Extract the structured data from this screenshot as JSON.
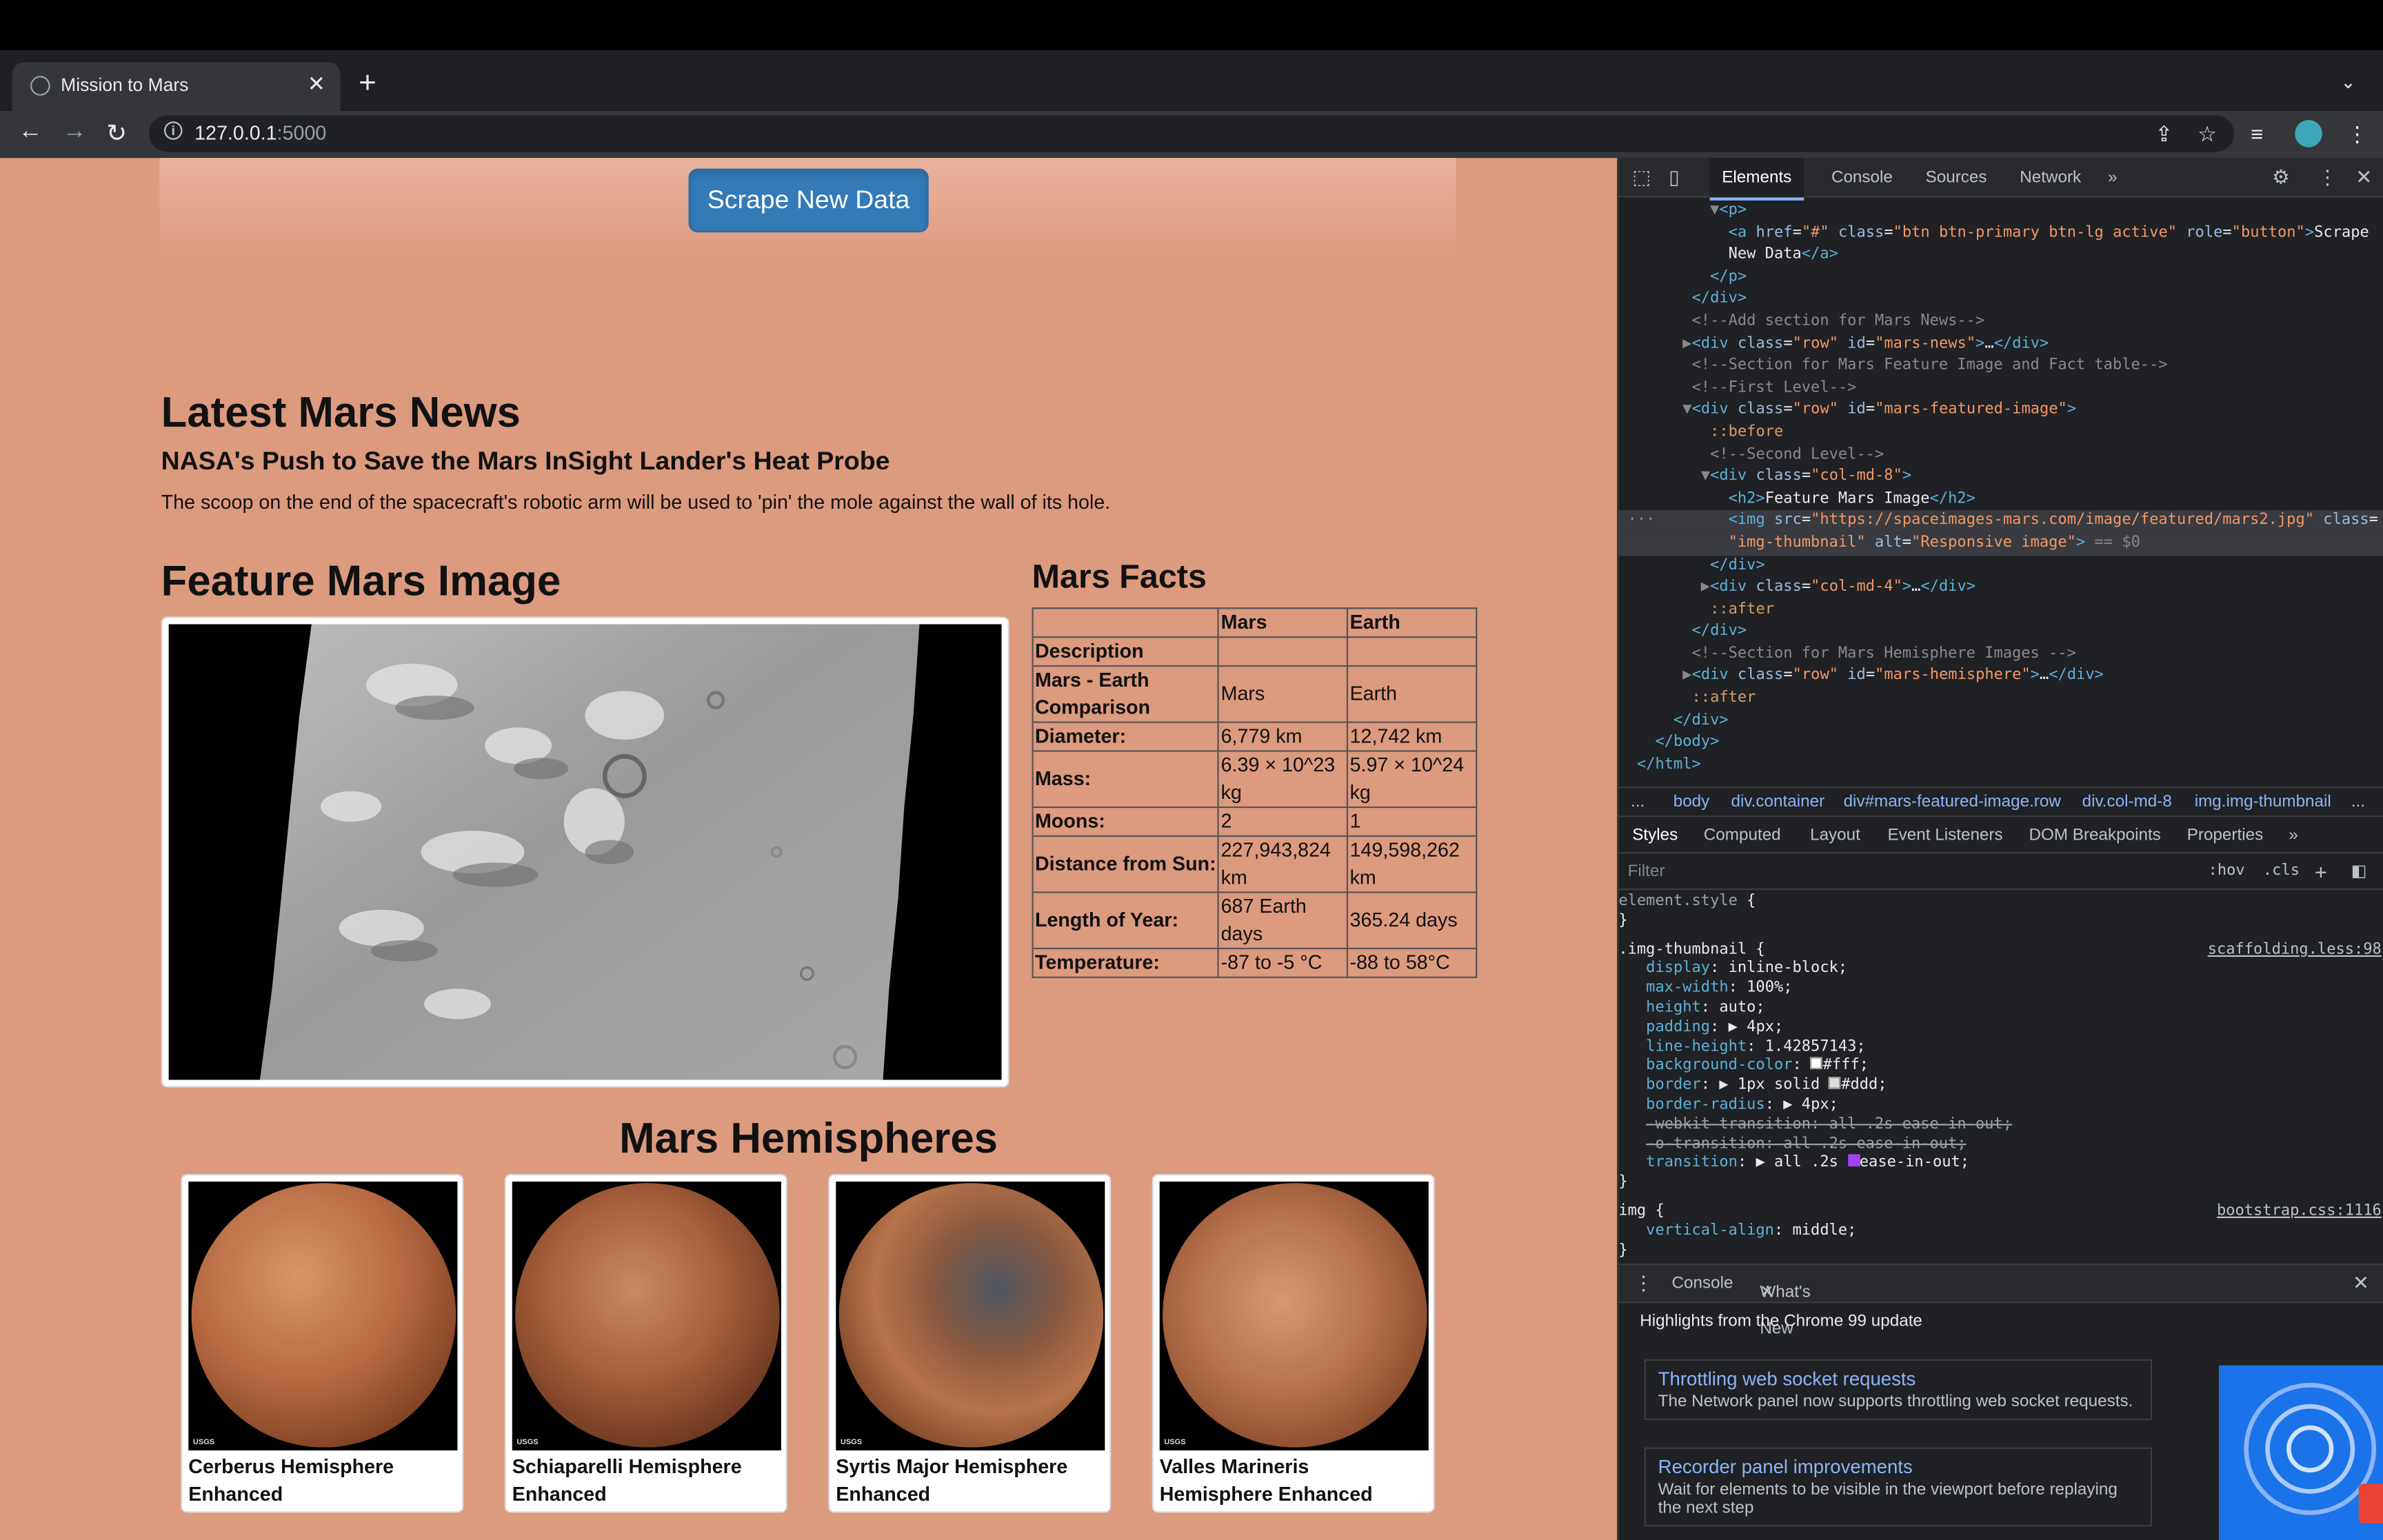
{
  "browser": {
    "tab_title": "Mission to Mars",
    "new_tab": "+",
    "url_host": "127.0.0.1",
    "url_port": ":5000"
  },
  "page": {
    "scrape_button": "Scrape New Data",
    "news_heading": "Latest Mars News",
    "news_title": "NASA's Push to Save the Mars InSight Lander's Heat Probe",
    "news_paragraph": "The scoop on the end of the spacecraft's robotic arm will be used to 'pin' the mole against the wall of its hole.",
    "featured_heading": "Feature Mars Image",
    "facts_heading": "Mars Facts",
    "facts_table": {
      "headers": [
        "",
        "Mars",
        "Earth"
      ],
      "rows": [
        [
          "Description",
          "",
          ""
        ],
        [
          "Mars - Earth Comparison",
          "Mars",
          "Earth"
        ],
        [
          "Diameter:",
          "6,779 km",
          "12,742 km"
        ],
        [
          "Mass:",
          "6.39 × 10^23 kg",
          "5.97 × 10^24 kg"
        ],
        [
          "Moons:",
          "2",
          "1"
        ],
        [
          "Distance from Sun:",
          "227,943,824 km",
          "149,598,262 km"
        ],
        [
          "Length of Year:",
          "687 Earth days",
          "365.24 days"
        ],
        [
          "Temperature:",
          "-87 to -5 °C",
          "-88 to 58°C"
        ]
      ]
    },
    "hemispheres_heading": "Mars Hemispheres",
    "hemispheres": [
      {
        "title": "Cerberus Hemisphere Enhanced"
      },
      {
        "title": "Schiaparelli Hemisphere Enhanced"
      },
      {
        "title": "Syrtis Major Hemisphere Enhanced"
      },
      {
        "title": "Valles Marineris Hemisphere Enhanced"
      }
    ],
    "usgs": "USGS"
  },
  "devtools": {
    "tabs": [
      "Elements",
      "Console",
      "Sources",
      "Network",
      "»"
    ],
    "breadcrumbs": [
      "...",
      "body",
      "div.container",
      "div#mars-featured-image.row",
      "div.col-md-8",
      "img.img-thumbnail",
      "..."
    ],
    "styles_tabs": [
      "Styles",
      "Computed",
      "Layout",
      "Event Listeners",
      "DOM Breakpoints",
      "Properties",
      "»"
    ],
    "filter_placeholder": "Filter",
    "hov": ":hov",
    "cls": ".cls",
    "drawer_tabs": [
      "Console",
      "What's New"
    ],
    "whats_new_heading": "Highlights from the Chrome 99 update",
    "cards": [
      {
        "title": "Throttling web socket requests",
        "desc": "The Network panel now supports throttling web socket requests."
      },
      {
        "title": "Recorder panel improvements",
        "desc": "Wait for elements to be visible in the viewport before replaying the next step"
      }
    ],
    "css_sources": [
      "scaffolding.less:98",
      "bootstrap.css:1116"
    ]
  }
}
